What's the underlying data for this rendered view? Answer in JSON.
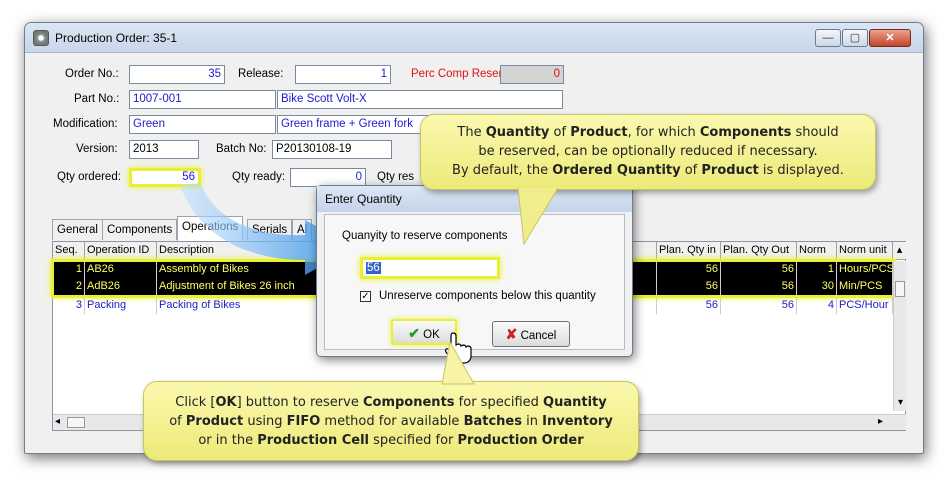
{
  "window": {
    "title": "Production Order: 35-1",
    "controls": {
      "minimize": "—",
      "maximize": "▢",
      "close": "✕"
    }
  },
  "form": {
    "order_no_label": "Order No.:",
    "order_no": "35",
    "release_label": "Release:",
    "release": "1",
    "perc_label": "Perc Comp Reserved:",
    "perc": "0",
    "part_no_label": "Part No.:",
    "part_no": "1007-001",
    "part_name": "Bike Scott Volt-X",
    "modification_label": "Modification:",
    "modification": "Green",
    "modification_desc": "Green frame + Green fork",
    "version_label": "Version:",
    "version": "2013",
    "batch_label": "Batch No:",
    "batch_no": "P20130108-19",
    "qty_ordered_label": "Qty ordered:",
    "qty_ordered": "56",
    "qty_ready_label": "Qty ready:",
    "qty_ready": "0",
    "qty_res_label": "Qty res"
  },
  "tabs": [
    "General",
    "Components",
    "Operations",
    "Serials",
    "Al"
  ],
  "grid": {
    "columns": [
      "Seq.",
      "Operation ID",
      "Description",
      "Plan. Qty in",
      "Plan. Qty Out",
      "Norm",
      "Norm unit"
    ],
    "rows": [
      {
        "seq": "1",
        "op": "AB26",
        "desc": "Assembly of Bikes",
        "qin": "56",
        "qout": "56",
        "norm": "1",
        "unit": "Hours/PCS"
      },
      {
        "seq": "2",
        "op": "AdB26",
        "desc": "Adjustment of Bikes 26 inch",
        "qin": "56",
        "qout": "56",
        "norm": "30",
        "unit": "Min/PCS"
      },
      {
        "seq": "3",
        "op": "Packing",
        "desc": "Packing of Bikes",
        "qin": "56",
        "qout": "56",
        "norm": "4",
        "unit": "PCS/Hour"
      }
    ]
  },
  "dialog": {
    "title": "Enter Quantity",
    "prompt": "Quanyity to reserve components",
    "quantity": "56",
    "checkbox_label": "Unreserve components below this quantity",
    "checkbox_checked": true,
    "ok": "OK",
    "cancel": "Cancel"
  },
  "callouts": {
    "top": [
      "The ",
      "Quantity",
      " of ",
      "Product",
      ", for which ",
      "Components",
      " should",
      "be reserved, can be optionally reduced if necessary.",
      "By default, the ",
      "Ordered Quantity",
      " of ",
      "Product",
      " is displayed."
    ],
    "bottom": [
      "Click [",
      "OK",
      "] button to reserve ",
      "Components",
      " for specified ",
      "Quantity",
      "of ",
      "Product",
      " using ",
      "FIFO",
      " method for available ",
      "Batches",
      " in ",
      "Inventory",
      "or in the ",
      "Production Cell",
      " specified for ",
      "Production",
      " ",
      "Order"
    ]
  },
  "colors": {
    "highlight": "#e9ef31",
    "callout": "#f5f29a",
    "blue_text": "#1b1bd0",
    "red_text": "#e01010"
  }
}
